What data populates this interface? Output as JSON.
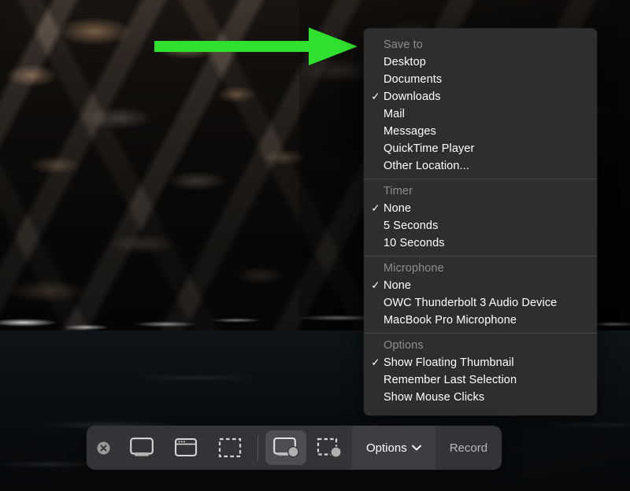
{
  "screen": {
    "wallpaper_description": "dark rocky cliff face above dark ocean water"
  },
  "annotation": {
    "arrow": {
      "name": "green-right-arrow",
      "color": "#2fe02f",
      "direction": "right"
    }
  },
  "options_menu": {
    "sections": [
      {
        "header": "Save to",
        "items": [
          {
            "label": "Desktop",
            "checked": false
          },
          {
            "label": "Documents",
            "checked": false
          },
          {
            "label": "Downloads",
            "checked": true
          },
          {
            "label": "Mail",
            "checked": false
          },
          {
            "label": "Messages",
            "checked": false
          },
          {
            "label": "QuickTime Player",
            "checked": false
          },
          {
            "label": "Other Location...",
            "checked": false
          }
        ]
      },
      {
        "header": "Timer",
        "items": [
          {
            "label": "None",
            "checked": true
          },
          {
            "label": "5 Seconds",
            "checked": false
          },
          {
            "label": "10 Seconds",
            "checked": false
          }
        ]
      },
      {
        "header": "Microphone",
        "items": [
          {
            "label": "None",
            "checked": true
          },
          {
            "label": "OWC Thunderbolt 3 Audio Device",
            "checked": false
          },
          {
            "label": "MacBook Pro Microphone",
            "checked": false
          }
        ]
      },
      {
        "header": "Options",
        "items": [
          {
            "label": "Show Floating Thumbnail",
            "checked": true
          },
          {
            "label": "Remember Last Selection",
            "checked": false
          },
          {
            "label": "Show Mouse Clicks",
            "checked": false
          }
        ]
      }
    ],
    "checkmark_glyph": "✓"
  },
  "toolbar": {
    "close_icon": "close-circle-icon",
    "tools": [
      {
        "name": "capture-entire-screen",
        "icon": "display-icon",
        "selected": false
      },
      {
        "name": "capture-selected-window",
        "icon": "window-icon",
        "selected": false
      },
      {
        "name": "capture-selected-portion",
        "icon": "dashed-rectangle-icon",
        "selected": false
      },
      {
        "name": "record-entire-screen",
        "icon": "display-record-icon",
        "selected": true
      },
      {
        "name": "record-selected-portion",
        "icon": "dashed-rectangle-record-icon",
        "selected": false
      }
    ],
    "options_label": "Options",
    "options_chevron": "chevron-down-icon",
    "record_label": "Record"
  },
  "colors": {
    "menu_background": "#2e2e2e",
    "menu_separator": "#464646",
    "menu_header_text": "#8d8d8d",
    "menu_item_text": "#ffffff",
    "toolbar_background": "#323437",
    "toolbar_selected": "#4c4e52",
    "toolbar_options_active": "#3c3e42",
    "arrow_green": "#2fe02f"
  }
}
